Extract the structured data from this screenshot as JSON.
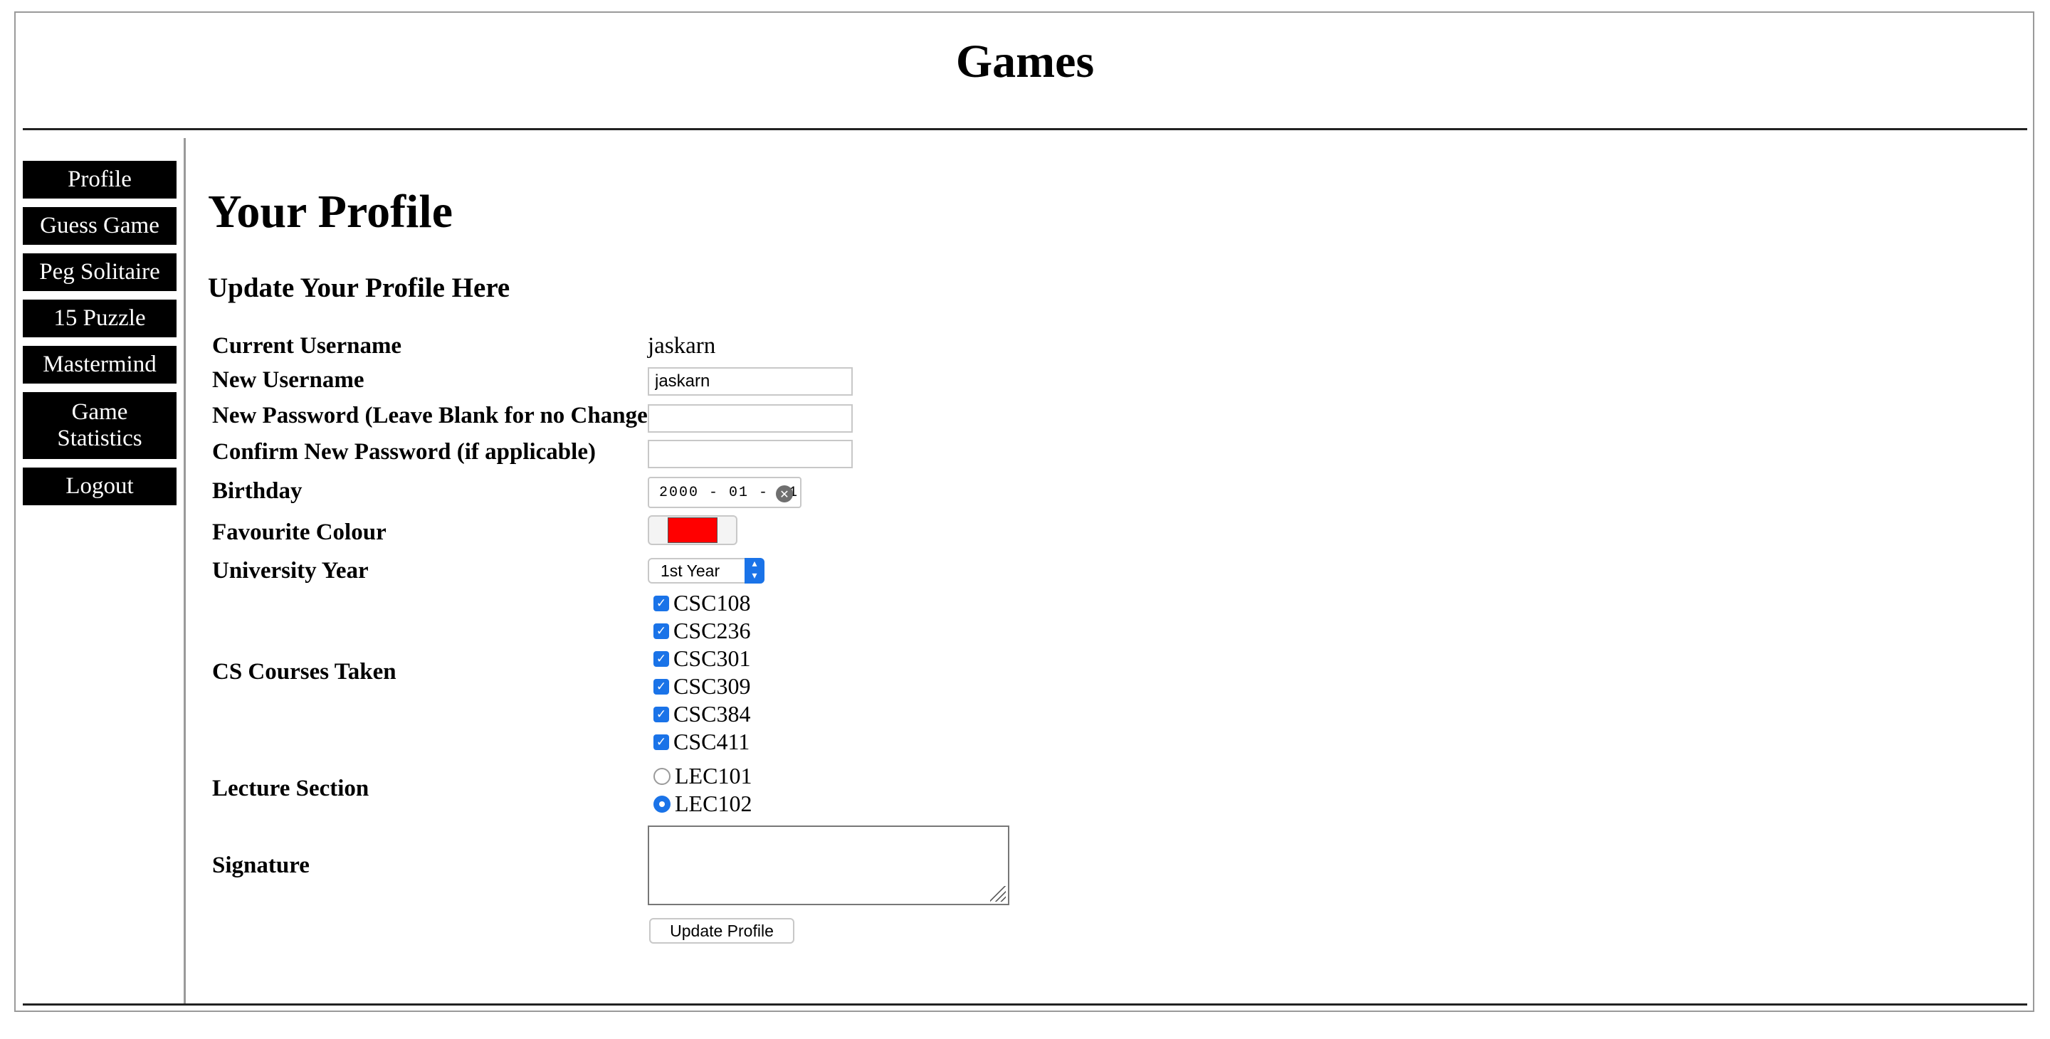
{
  "site": {
    "title": "Games"
  },
  "nav": {
    "items": [
      {
        "label": "Profile"
      },
      {
        "label": "Guess Game"
      },
      {
        "label": "Peg Solitaire"
      },
      {
        "label": "15 Puzzle"
      },
      {
        "label": "Mastermind"
      },
      {
        "label_line1": "Game",
        "label_line2": "Statistics"
      },
      {
        "label": "Logout"
      }
    ]
  },
  "page": {
    "title": "Your Profile",
    "subtitle": "Update Your Profile Here"
  },
  "form": {
    "current_username": {
      "label": "Current Username",
      "value": "jaskarn"
    },
    "new_username": {
      "label": "New Username",
      "value": "jaskarn"
    },
    "new_password": {
      "label": "New Password (Leave Blank for no Change)",
      "value": ""
    },
    "confirm_password": {
      "label": "Confirm New Password (if applicable)",
      "value": ""
    },
    "birthday": {
      "label": "Birthday",
      "value": "2000 - 01 - 01"
    },
    "favourite_colour": {
      "label": "Favourite Colour",
      "value": "#ff0000"
    },
    "university_year": {
      "label": "University Year",
      "selected": "1st Year"
    },
    "courses": {
      "label": "CS Courses Taken",
      "items": [
        {
          "code": "CSC108",
          "checked": true
        },
        {
          "code": "CSC236",
          "checked": true
        },
        {
          "code": "CSC301",
          "checked": true
        },
        {
          "code": "CSC309",
          "checked": true
        },
        {
          "code": "CSC384",
          "checked": true
        },
        {
          "code": "CSC411",
          "checked": true
        }
      ]
    },
    "lecture_section": {
      "label": "Lecture Section",
      "options": [
        {
          "code": "LEC101",
          "selected": false
        },
        {
          "code": "LEC102",
          "selected": true
        }
      ]
    },
    "signature": {
      "label": "Signature",
      "value": ""
    },
    "submit_label": "Update Profile"
  },
  "colors": {
    "accent": "#1a73e8",
    "nav_bg": "#000000",
    "nav_text": "#ffffff"
  }
}
